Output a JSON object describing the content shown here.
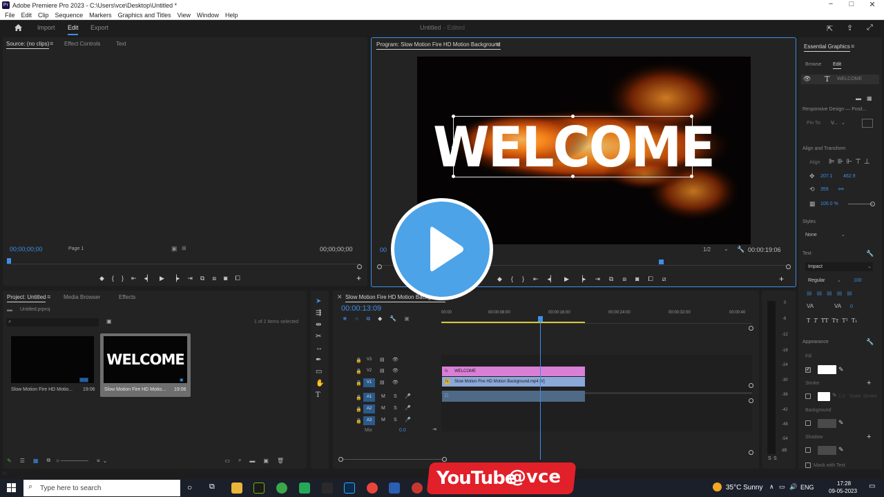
{
  "titlebar": {
    "app_icon": "Pr",
    "title": "Adobe Premiere Pro 2023 - C:\\Users\\vce\\Desktop\\Untitled *",
    "minimize": "−",
    "maximize": "□",
    "close": "✕"
  },
  "menu": [
    "File",
    "Edit",
    "Clip",
    "Sequence",
    "Markers",
    "Graphics and Titles",
    "View",
    "Window",
    "Help"
  ],
  "workspace": {
    "tabs": [
      "Import",
      "Edit",
      "Export"
    ],
    "active_tab": "Edit",
    "project_name": "Untitled",
    "project_state": "- Edited"
  },
  "source_panel": {
    "tabs": [
      "Source: (no clips)",
      "Effect Controls",
      "Text"
    ],
    "timecode_left": "00;00;00;00",
    "page_label": "Page 1",
    "timecode_right": "00;00;00;00"
  },
  "program_panel": {
    "title": "Program: Slow Motion Fire HD Motion Background",
    "overlay_text": "WELCOME",
    "timecode_left": "00",
    "resolution": "1/2",
    "timecode_right": "00:00:19:06"
  },
  "essential_graphics": {
    "title": "Essential Graphics",
    "tabs": [
      "Browse",
      "Edit"
    ],
    "layer_name": "WELCOME",
    "responsive_design": "Responsive Design — Posit...",
    "pin_to_label": "Pin To:",
    "pin_to_value": "V...",
    "align_transform": "Align and Transform",
    "align_label": "Align",
    "pos_x": "207.1",
    "pos_y": "462.9",
    "rotation": "359",
    "scale": "100.0 %",
    "styles_label": "Styles",
    "styles_value": "None",
    "text_label": "Text",
    "font": "Impact",
    "font_style": "Regular",
    "font_size": "100",
    "tracking_value": "0",
    "appearance_label": "Appearance",
    "fill_label": "Fill",
    "stroke_label": "Stroke",
    "stroke_width": "1.0",
    "stroke_mode": "Outer Stroke",
    "background_label": "Background",
    "shadow_label": "Shadow",
    "mask_label": "Mask with Text"
  },
  "project_panel": {
    "tabs": [
      "Project: Untitled",
      "Media Browser",
      "Effects"
    ],
    "path": "Untitled.prproj",
    "items_selected": "1 of 2 items selected",
    "items": [
      {
        "name": "Slow Motion Fire HD Motio...",
        "duration": "19:06"
      },
      {
        "name": "Slow Motion Fire HD Motio...",
        "duration": "19:06",
        "thumb_text": "WELCOME"
      }
    ]
  },
  "timeline": {
    "sequence_name": "Slow Motion Fire HD Motion Background",
    "timecode": "00:00:13:09",
    "ruler": [
      "00:00",
      "00:00:08:00",
      "00:00:16:00",
      "00:00:24:00",
      "00:00:32:00",
      "00:00:40"
    ],
    "video_tracks": [
      "V3",
      "V2",
      "V1"
    ],
    "audio_tracks": [
      "A1",
      "A2",
      "A3"
    ],
    "mix_label": "Mix",
    "mix_value": "0.0",
    "track_buttons": {
      "mute": "M",
      "solo": "S"
    },
    "clips": {
      "graphic": "WELCOME",
      "video": "Slow Motion Fire HD Motion Background.mp4 [V]"
    }
  },
  "audio_meter": {
    "scale": [
      "0",
      "-6",
      "-12",
      "-18",
      "-24",
      "-30",
      "-36",
      "-42",
      "-48",
      "-54",
      "dB"
    ],
    "solo_labels": [
      "S",
      "S"
    ]
  },
  "overlay": {
    "play_button": "play-icon",
    "youtube_text": "You",
    "youtube_tube": "Tube",
    "handle": "@vce"
  },
  "taskbar": {
    "search_placeholder": "Type here to search",
    "weather": "35°C  Sunny",
    "language": "ENG",
    "time": "17:28",
    "date": "09-05-2023"
  },
  "colors": {
    "accent_blue": "#3f8ee8",
    "graphic_clip": "#d97fd6",
    "video_clip": "#8aa8d8",
    "audio_clip": "#4f6a86",
    "play_blue": "#4ca3e8",
    "youtube_red": "#e1202a"
  }
}
